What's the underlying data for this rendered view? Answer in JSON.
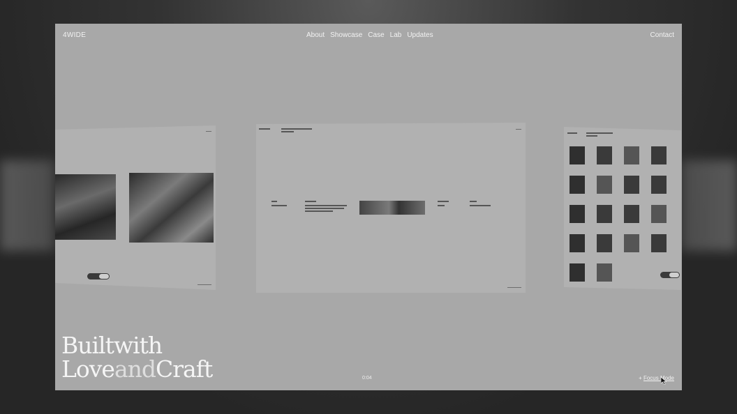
{
  "brand": {
    "logo": "4WIDE"
  },
  "nav": {
    "links": [
      "About",
      "Showcase",
      "Case",
      "Lab",
      "Updates"
    ],
    "contact": "Contact"
  },
  "hero": {
    "line1": "Builtwith",
    "line2a": "Love",
    "line2b": "and",
    "line2c": "Craft"
  },
  "footer": {
    "counter": "0:04",
    "focus_prefix": "+",
    "focus_label": "Focus Mode"
  },
  "icons": {
    "cursor": "arrow-cursor-icon"
  }
}
